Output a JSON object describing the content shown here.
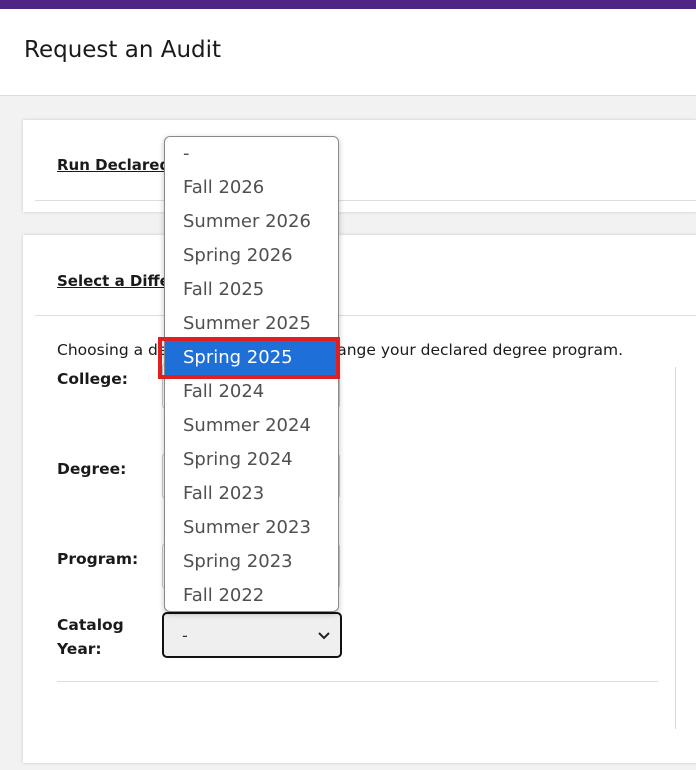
{
  "page": {
    "title": "Request an Audit"
  },
  "colors": {
    "brand_bar": "#4f2683",
    "selected_option": "#1f6fd9",
    "highlight": "#e02020"
  },
  "declared_card": {
    "link_text": "Run Declared"
  },
  "different_card": {
    "link_text": "Select a Differ",
    "info_before": "Choosing a de",
    "info_after": "ot change your declared degree program."
  },
  "fields": {
    "college_label": "College:",
    "degree_label": "Degree:",
    "program_label": "Program:",
    "catalog_label_line1": "Catalog",
    "catalog_label_line2": "Year:"
  },
  "catalog_select": {
    "value": "-",
    "icon": "chevron-down-icon"
  },
  "dropdown": {
    "options": [
      "-",
      "Fall 2026",
      "Summer 2026",
      "Spring 2026",
      "Fall 2025",
      "Summer 2025",
      "Spring 2025",
      "Fall 2024",
      "Summer 2024",
      "Spring 2024",
      "Fall 2023",
      "Summer 2023",
      "Spring 2023",
      "Fall 2022"
    ],
    "selected": "Spring 2025"
  }
}
